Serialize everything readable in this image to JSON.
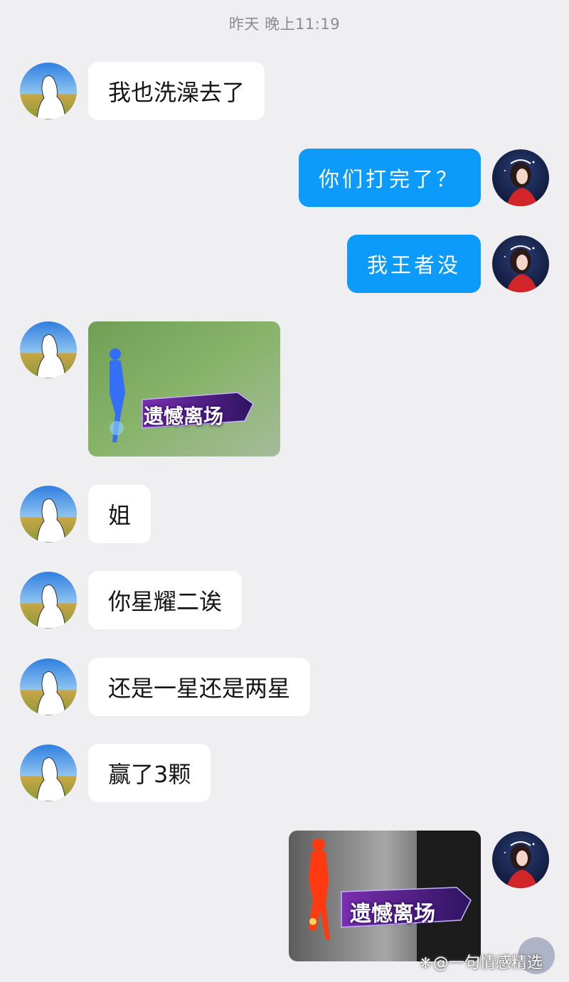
{
  "header": {
    "timestamp": "昨天 晚上11:19"
  },
  "messages": [
    {
      "side": "in",
      "type": "text",
      "text": "我也洗澡去了"
    },
    {
      "side": "out",
      "type": "text",
      "text": "你们打完了？"
    },
    {
      "side": "out",
      "type": "text",
      "text": "我王者没"
    },
    {
      "side": "in",
      "type": "sticker",
      "caption": "遗憾离场",
      "figure_color": "#2f6bff"
    },
    {
      "side": "in",
      "type": "text",
      "text": "姐"
    },
    {
      "side": "in",
      "type": "text",
      "text": "你星耀二诶"
    },
    {
      "side": "in",
      "type": "text",
      "text": "还是一星还是两星"
    },
    {
      "side": "in",
      "type": "text",
      "text": "赢了3颗"
    },
    {
      "side": "out",
      "type": "sticker",
      "caption": "遗憾离场",
      "figure_color": "#ff3a10"
    }
  ],
  "watermark": {
    "icon": "paw-icon",
    "text": "@一句情感精选"
  },
  "colors": {
    "background": "#efeff1",
    "incoming_bubble": "#ffffff",
    "outgoing_bubble": "#0c9bfb"
  }
}
